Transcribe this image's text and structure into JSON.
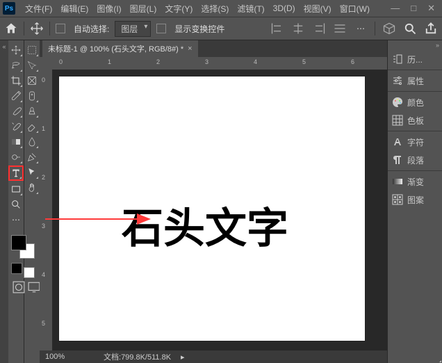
{
  "menus": [
    "文件(F)",
    "编辑(E)",
    "图像(I)",
    "图层(L)",
    "文字(Y)",
    "选择(S)",
    "滤镜(T)",
    "3D(D)",
    "视图(V)",
    "窗口(W)"
  ],
  "optbar": {
    "auto_select_label": "自动选择:",
    "layer_label": "图层",
    "show_transform_label": "显示变换控件"
  },
  "doc": {
    "tab_title": "未标题-1 @ 100% (石头文字, RGB/8#) *",
    "canvas_text": "石头文字"
  },
  "ruler_h": {
    "0": "0",
    "1": "1",
    "2": "2",
    "3": "3",
    "4": "4",
    "5": "5",
    "6": "6"
  },
  "ruler_v": {
    "0": "0",
    "1": "1",
    "2": "2",
    "3": "3",
    "4": "4",
    "5": "5"
  },
  "status": {
    "zoom": "100%",
    "docinfo_label": "文档:",
    "docinfo_value": "799.8K/511.8K"
  },
  "panels": [
    "历...",
    "属性",
    "颜色",
    "色板",
    "字符",
    "段落",
    "渐变",
    "图案"
  ]
}
